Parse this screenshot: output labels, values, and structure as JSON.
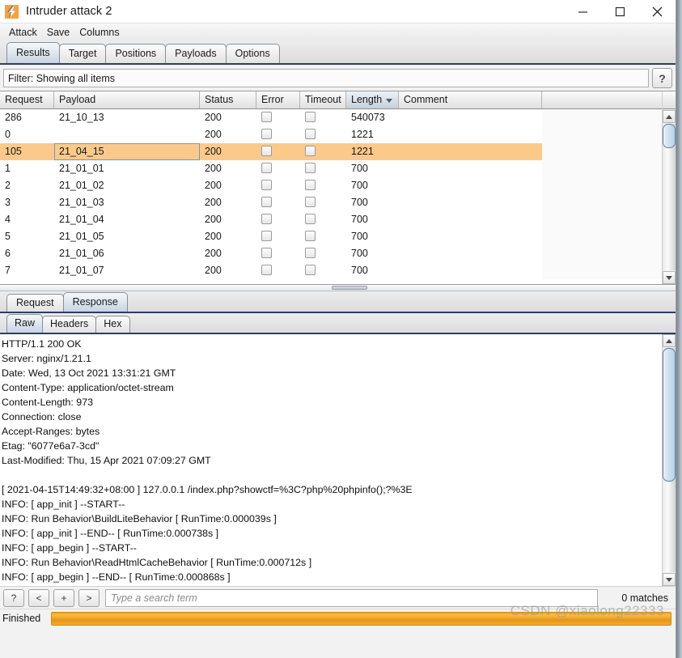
{
  "window": {
    "title": "Intruder attack 2",
    "icon": "burp-lightning-icon",
    "minimize_label": "—",
    "maximize_label": "□",
    "close_label": "✕"
  },
  "menubar": {
    "items": [
      "Attack",
      "Save",
      "Columns"
    ]
  },
  "main_tabs": {
    "items": [
      "Results",
      "Target",
      "Positions",
      "Payloads",
      "Options"
    ],
    "active": "Results"
  },
  "filter": {
    "text": "Filter: Showing all items",
    "help_label": "?"
  },
  "results_table": {
    "columns": [
      "Request",
      "Payload",
      "Status",
      "Error",
      "Timeout",
      "Length",
      "Comment"
    ],
    "sorted_column": "Length",
    "sort_direction": "descending",
    "selected_row_index": 2,
    "selection_color": "#fbca8a",
    "rows": [
      {
        "request": "286",
        "payload": "21_10_13",
        "status": "200",
        "error": false,
        "timeout": false,
        "length": "540073",
        "comment": ""
      },
      {
        "request": "0",
        "payload": "",
        "status": "200",
        "error": false,
        "timeout": false,
        "length": "1221",
        "comment": ""
      },
      {
        "request": "105",
        "payload": "21_04_15",
        "status": "200",
        "error": false,
        "timeout": false,
        "length": "1221",
        "comment": ""
      },
      {
        "request": "1",
        "payload": "21_01_01",
        "status": "200",
        "error": false,
        "timeout": false,
        "length": "700",
        "comment": ""
      },
      {
        "request": "2",
        "payload": "21_01_02",
        "status": "200",
        "error": false,
        "timeout": false,
        "length": "700",
        "comment": ""
      },
      {
        "request": "3",
        "payload": "21_01_03",
        "status": "200",
        "error": false,
        "timeout": false,
        "length": "700",
        "comment": ""
      },
      {
        "request": "4",
        "payload": "21_01_04",
        "status": "200",
        "error": false,
        "timeout": false,
        "length": "700",
        "comment": ""
      },
      {
        "request": "5",
        "payload": "21_01_05",
        "status": "200",
        "error": false,
        "timeout": false,
        "length": "700",
        "comment": ""
      },
      {
        "request": "6",
        "payload": "21_01_06",
        "status": "200",
        "error": false,
        "timeout": false,
        "length": "700",
        "comment": ""
      },
      {
        "request": "7",
        "payload": "21_01_07",
        "status": "200",
        "error": false,
        "timeout": false,
        "length": "700",
        "comment": ""
      }
    ]
  },
  "message_tabs": {
    "items": [
      "Request",
      "Response"
    ],
    "active": "Response"
  },
  "view_tabs": {
    "items": [
      "Raw",
      "Headers",
      "Hex"
    ],
    "active": "Raw"
  },
  "response": {
    "lines": [
      "HTTP/1.1 200 OK",
      "Server: nginx/1.21.1",
      "Date: Wed, 13 Oct 2021 13:31:21 GMT",
      "Content-Type: application/octet-stream",
      "Content-Length: 973",
      "Connection: close",
      "Accept-Ranges: bytes",
      "Etag: \"6077e6a7-3cd\"",
      "Last-Modified: Thu, 15 Apr 2021 07:09:27 GMT",
      "",
      "[ 2021-04-15T14:49:32+08:00 ] 127.0.0.1 /index.php?showctf=%3C?php%20phpinfo();?%3E",
      "INFO: [ app_init ] --START--",
      "INFO: Run Behavior\\BuildLiteBehavior [ RunTime:0.000039s ]",
      "INFO: [ app_init ] --END-- [ RunTime:0.000738s ]",
      "INFO: [ app_begin ] --START--",
      "INFO: Run Behavior\\ReadHtmlCacheBehavior [ RunTime:0.000712s ]",
      "INFO: [ app_begin ] --END-- [ RunTime:0.000868s ]"
    ]
  },
  "search": {
    "help_label": "?",
    "prev_label": "<",
    "add_label": "+",
    "next_label": ">",
    "placeholder": "Type a search term",
    "value": "",
    "match_count": "0 matches"
  },
  "status": {
    "label": "Finished",
    "progress_percent": 100,
    "progress_color": "#f0a81f",
    "watermark": "CSDN @xiaolong22333"
  }
}
